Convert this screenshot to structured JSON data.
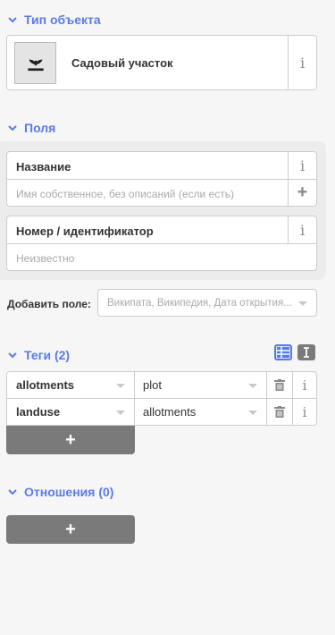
{
  "preset": {
    "header": "Тип объекта",
    "name": "Садовый участок",
    "info_glyph": "i",
    "icon": "garden-sprout-icon"
  },
  "fields": {
    "header": "Поля",
    "name_field": {
      "label": "Название",
      "placeholder": "Имя собственное, без описаний (если есть)",
      "add_glyph": "+"
    },
    "ref_field": {
      "label": "Номер / идентификатор",
      "placeholder": "Неизвестно"
    },
    "add_field": {
      "label": "Добавить поле:",
      "placeholder": "Википата, Википедия, Дата открытия..."
    }
  },
  "tags": {
    "header": "Теги (2)",
    "rows": [
      {
        "key": "allotments",
        "value": "plot"
      },
      {
        "key": "landuse",
        "value": "allotments"
      }
    ],
    "add_glyph": "+"
  },
  "relations": {
    "header": "Отношения (0)",
    "add_glyph": "+"
  },
  "colors": {
    "accent": "#597be7",
    "button": "#7a7a7a"
  }
}
